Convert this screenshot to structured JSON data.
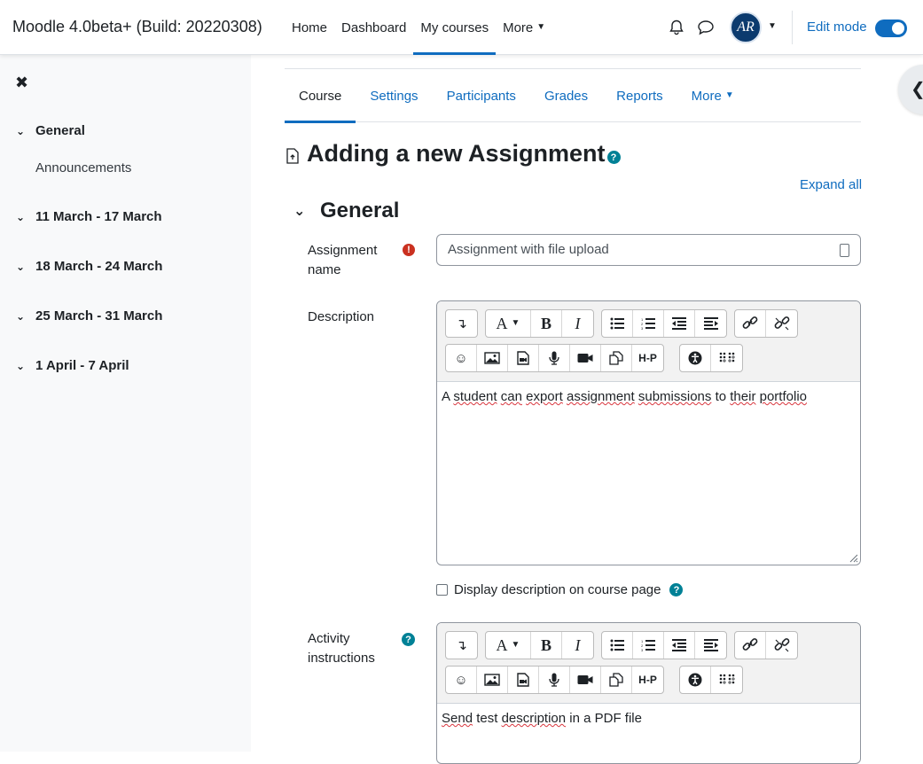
{
  "app": {
    "title": "Moodle 4.0beta+ (Build: 20220308)"
  },
  "primary_nav": [
    {
      "label": "Home",
      "active": false
    },
    {
      "label": "Dashboard",
      "active": false
    },
    {
      "label": "My courses",
      "active": true
    },
    {
      "label": "More",
      "active": false
    }
  ],
  "user": {
    "avatar_initials": "AR"
  },
  "edit_mode": {
    "label": "Edit mode",
    "on": true
  },
  "drawer": {
    "items": [
      {
        "label": "General",
        "expanded": true,
        "children": [
          "Announcements"
        ]
      },
      {
        "label": "11 March - 17 March",
        "expanded": true
      },
      {
        "label": "18 March - 24 March",
        "expanded": true
      },
      {
        "label": "25 March - 31 March",
        "expanded": true
      },
      {
        "label": "1 April - 7 April",
        "expanded": true
      }
    ]
  },
  "secondary_nav": [
    {
      "label": "Course",
      "active": true
    },
    {
      "label": "Settings"
    },
    {
      "label": "Participants"
    },
    {
      "label": "Grades"
    },
    {
      "label": "Reports"
    },
    {
      "label": "More"
    }
  ],
  "page": {
    "title": "Adding a new Assignment",
    "expand_all": "Expand all",
    "section_title": "General"
  },
  "form": {
    "assignment_name": {
      "label_line1": "Assignment",
      "label_line2": "name",
      "value": "Assignment with file upload"
    },
    "description": {
      "label": "Description",
      "text_parts": [
        "A ",
        "student",
        " ",
        "can",
        " ",
        "export",
        " ",
        "assignment",
        " ",
        "submissions",
        " to ",
        "their",
        " ",
        "portfolio"
      ]
    },
    "display_on_course_page": {
      "label": "Display description on course page",
      "checked": false
    },
    "activity_instructions": {
      "label_line1": "Activity",
      "label_line2": "instructions",
      "text_parts": [
        "Send",
        " test ",
        "description",
        " in a PDF file"
      ]
    }
  },
  "editor_toolbar": {
    "row1": [
      "collapse",
      "font-color",
      "bold",
      "italic",
      "bullet-list",
      "numbered-list",
      "outdent",
      "indent",
      "link",
      "unlink"
    ],
    "row2": [
      "emoji",
      "image",
      "media-file",
      "record-audio",
      "record-video",
      "manage-files",
      "h5p",
      "accessibility-checker",
      "screenreader-helper"
    ],
    "bold_glyph": "B",
    "italic_glyph": "I",
    "font_glyph": "A",
    "h5p_glyph": "H-P"
  },
  "colors": {
    "accent": "#0f6cbf",
    "danger": "#ca3120",
    "help": "#008196"
  }
}
